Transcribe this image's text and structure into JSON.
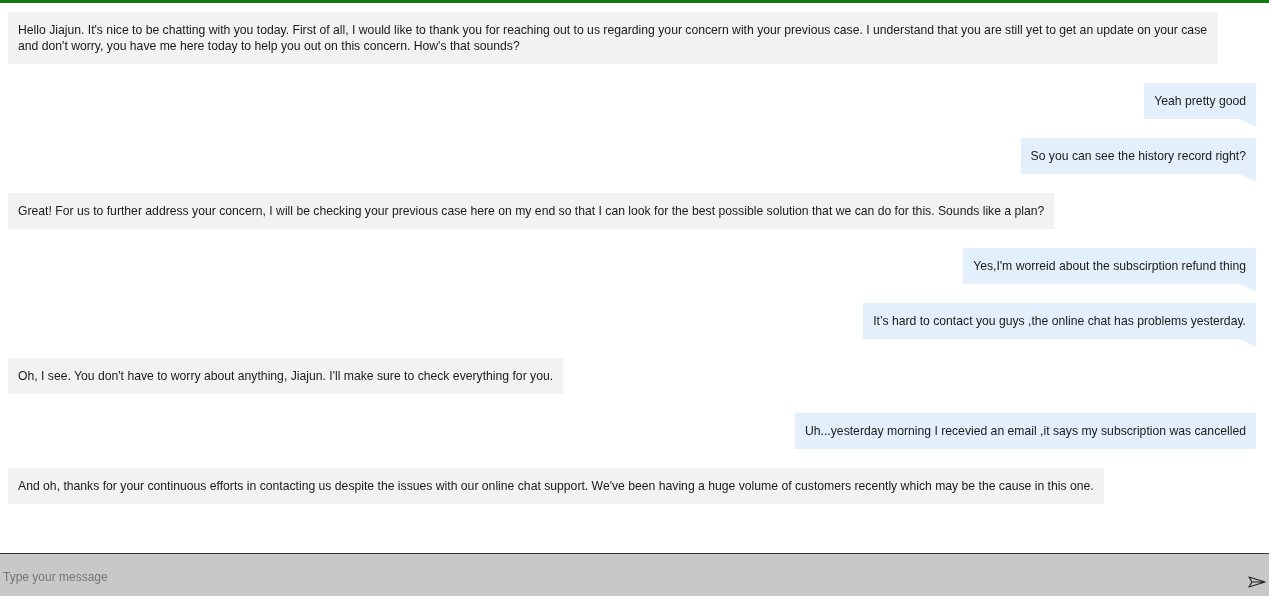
{
  "messages": [
    {
      "kind": "agent",
      "text": "Hello Jiajun. It's nice to be chatting with you today. First of all, I would like to thank you for reaching out to us regarding your concern with your previous case. I understand that you are still yet to get an update on your case and don't worry, you have me here today to help you out on this concern. How's that sounds?",
      "tail": false
    },
    {
      "kind": "user",
      "text": "Yeah pretty good",
      "tail": true
    },
    {
      "kind": "user",
      "text": "So you can see the history record right?",
      "tail": true
    },
    {
      "kind": "agent",
      "text": "Great! For us to further address your concern, I will be checking your previous case here on my end so that I can look for the best possible solution that we can do for this. Sounds like a plan?",
      "tail": false
    },
    {
      "kind": "user",
      "text": "Yes,I'm worreid about the subscirption refund thing",
      "tail": true
    },
    {
      "kind": "user",
      "text": "It’s hard to contact you guys ,the online chat has problems yesterday.",
      "tail": true
    },
    {
      "kind": "agent",
      "text": "Oh, I see. You don't have to worry about anything, Jiajun. I'll make sure to check everything for you.",
      "tail": false
    },
    {
      "kind": "user",
      "text": "Uh...yesterday morning I recevied an email ,it says my subscription was cancelled",
      "tail": false
    },
    {
      "kind": "agent",
      "text": "And oh, thanks for your continuous efforts in contacting us despite the issues with our online chat support. We've been having a huge volume of customers recently which may be the cause in this one.",
      "tail": false
    }
  ],
  "composer": {
    "placeholder": "Type your message"
  }
}
